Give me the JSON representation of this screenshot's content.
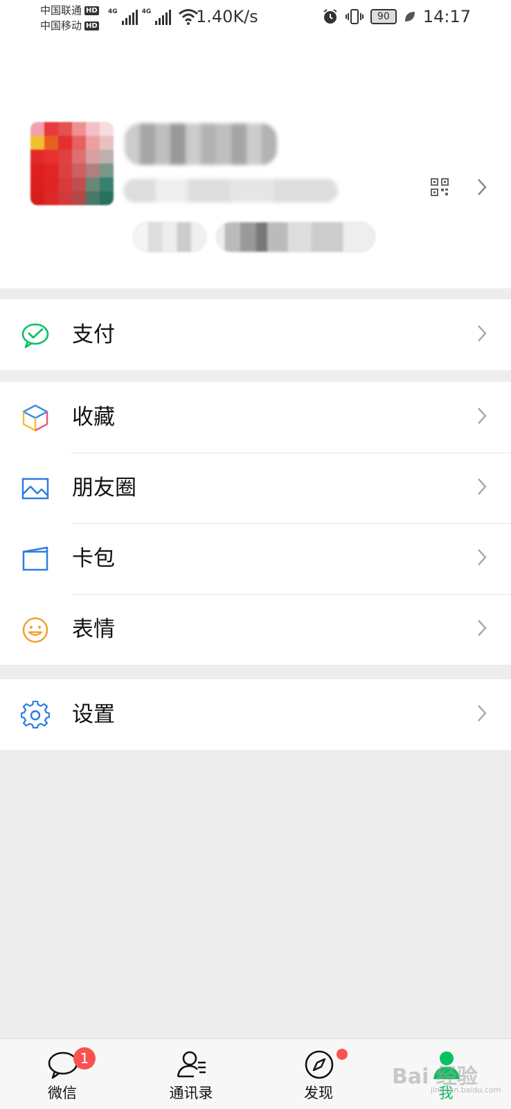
{
  "status_bar": {
    "carrier_1": "中国联通",
    "carrier_2": "中国移动",
    "hd_badge": "HD",
    "network_type": "4G",
    "net_speed": "1.40K/s",
    "battery_level": "90",
    "time": "14:17",
    "icons": [
      "alarm-icon",
      "vibrate-icon",
      "battery-icon",
      "leaf-icon",
      "wifi-icon",
      "signal-icon"
    ]
  },
  "profile": {
    "qr_icon": "qr-code-icon",
    "chevron_icon": "chevron-right-icon"
  },
  "menu": {
    "pay": {
      "label": "支付",
      "icon": "wechat-pay-icon",
      "color": "#07c160"
    },
    "favorites": {
      "label": "收藏",
      "icon": "cube-icon"
    },
    "moments": {
      "label": "朋友圈",
      "icon": "image-icon",
      "color": "#2b7de2"
    },
    "cards": {
      "label": "卡包",
      "icon": "card-icon",
      "color": "#2b7de2"
    },
    "stickers": {
      "label": "表情",
      "icon": "smile-icon",
      "color": "#f0a030"
    },
    "settings": {
      "label": "设置",
      "icon": "gear-icon",
      "color": "#2b7de2"
    }
  },
  "tab_bar": {
    "chats": {
      "label": "微信",
      "badge": "1",
      "icon": "chat-bubble-icon"
    },
    "contacts": {
      "label": "通讯录",
      "icon": "contacts-icon"
    },
    "discover": {
      "label": "发现",
      "icon": "compass-icon"
    },
    "me": {
      "label": "我",
      "icon": "person-icon",
      "active": true
    }
  },
  "watermark": {
    "text": "Bai 经验",
    "sub": "jingyan.baidu.com"
  },
  "colors": {
    "accent": "#07c160",
    "badge": "#fa5151",
    "background": "#ededed"
  }
}
